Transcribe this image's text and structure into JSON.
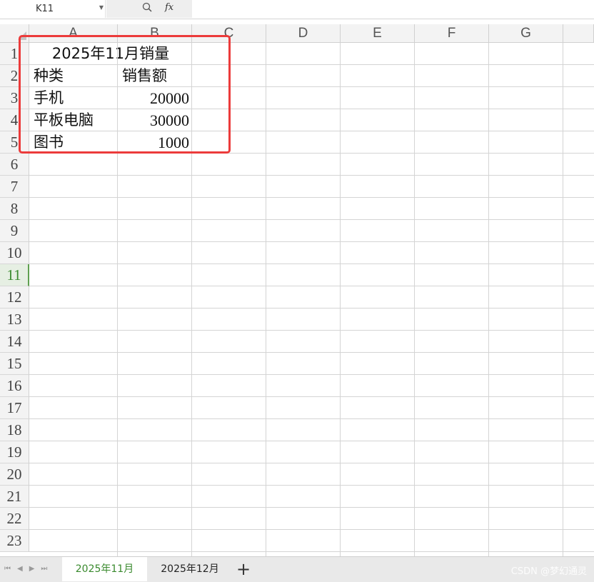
{
  "formula_bar": {
    "cell_reference": "K11",
    "fx_label": "fx",
    "formula_value": ""
  },
  "columns": [
    "A",
    "B",
    "C",
    "D",
    "E",
    "F",
    "G"
  ],
  "rows": [
    "1",
    "2",
    "3",
    "4",
    "5",
    "6",
    "7",
    "8",
    "9",
    "10",
    "11",
    "12",
    "13",
    "14",
    "15",
    "16",
    "17",
    "18",
    "19",
    "20",
    "21",
    "22",
    "23"
  ],
  "active_row": "11",
  "sheet": {
    "title": "2025年11月销量",
    "headers": [
      "种类",
      "销售额"
    ],
    "data": [
      {
        "category": "手机",
        "sales": "20000"
      },
      {
        "category": "平板电脑",
        "sales": "30000"
      },
      {
        "category": "图书",
        "sales": "1000"
      }
    ]
  },
  "tabs": {
    "active": "2025年11月",
    "other": "2025年12月",
    "add_label": "+"
  },
  "watermark": "CSDN @梦幻通灵",
  "colors": {
    "highlight_border": "#ec3b3b",
    "active_accent": "#3a8a2e"
  }
}
